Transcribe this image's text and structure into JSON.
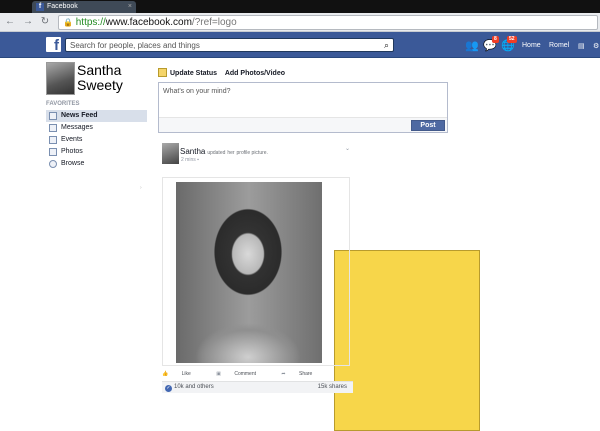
{
  "browser": {
    "tab_title": "Facebook",
    "tab_close": "×",
    "url_scheme": "https://",
    "url_host": "www.facebook.com",
    "url_path": "/?ref=logo"
  },
  "topbar": {
    "logo": "f",
    "search_placeholder": "Search for people, places and things",
    "friend_requests_badge": "",
    "messages_badge": "8",
    "notifications_badge": "52",
    "home_label": "Home",
    "profile_label": "Romel"
  },
  "sidebar": {
    "profile_name_line1": "Santha",
    "profile_name_line2": "Sweety",
    "favorites_heading": "FAVORITES",
    "items": [
      {
        "label": "News Feed"
      },
      {
        "label": "Messages"
      },
      {
        "label": "Events"
      },
      {
        "label": "Photos"
      },
      {
        "label": "Browse"
      }
    ]
  },
  "composer": {
    "update_status": "Update Status",
    "add_photos": "Add Photos/Video",
    "placeholder": "What's on your mind?",
    "post_button": "Post"
  },
  "story": {
    "author": "Santha",
    "action_prefix": "updated",
    "action_small": "her",
    "action_suffix": "profile picture.",
    "time": "2 mins",
    "like": "Like",
    "comment": "Comment",
    "share": "Share",
    "likes_text": "10k and others",
    "shares_text": "15k shares"
  }
}
